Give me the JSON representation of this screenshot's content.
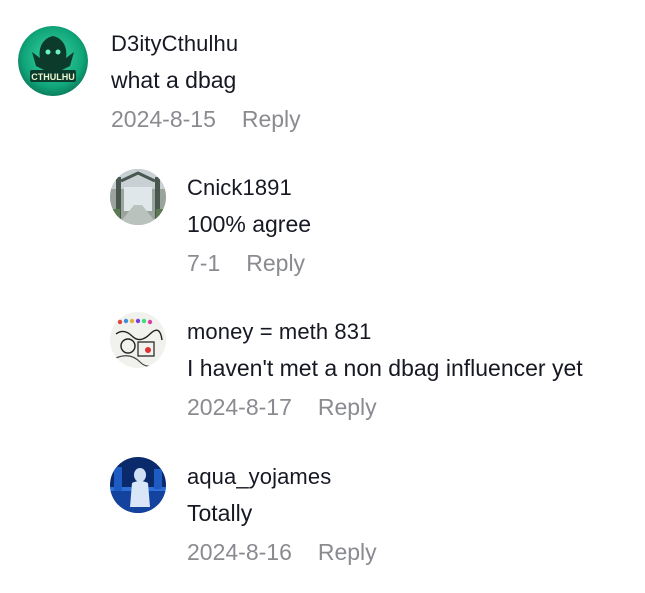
{
  "comments": [
    {
      "username": "D3ityCthulhu",
      "text": "what a dbag",
      "date": "2024-8-15",
      "reply_label": "Reply",
      "avatar_text": "CTHULHU"
    },
    {
      "username": "Cnick1891",
      "text": "100% agree",
      "date": "7-1",
      "reply_label": "Reply"
    },
    {
      "username": "money = meth 831",
      "text": "I haven't met a non dbag influencer yet",
      "date": "2024-8-17",
      "reply_label": "Reply"
    },
    {
      "username": "aqua_yojames",
      "text": "Totally",
      "date": "2024-8-16",
      "reply_label": "Reply"
    }
  ]
}
